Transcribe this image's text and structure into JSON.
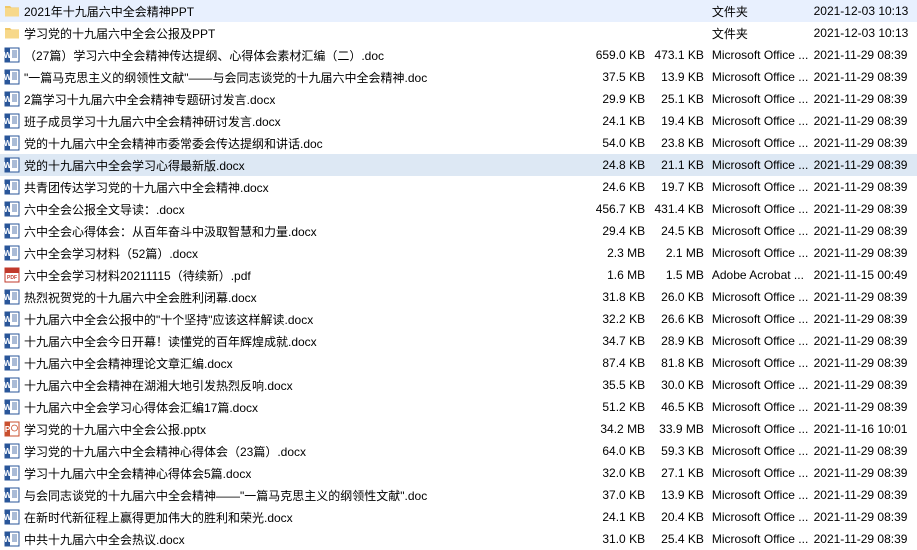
{
  "files": [
    {
      "icon": "folder",
      "name": "2021年十九届六中全会精神PPT",
      "size": "",
      "packed": "",
      "type": "文件夹",
      "date": "2021-12-03 10:13",
      "selected": false
    },
    {
      "icon": "folder",
      "name": "学习党的十九届六中全会公报及PPT",
      "size": "",
      "packed": "",
      "type": "文件夹",
      "date": "2021-12-03 10:13",
      "selected": false
    },
    {
      "icon": "word",
      "name": "（27篇）学习六中全会精神传达提纲、心得体会素材汇编（二）.doc",
      "size": "659.0 KB",
      "packed": "473.1 KB",
      "type": "Microsoft Office ...",
      "date": "2021-11-29 08:39",
      "selected": false
    },
    {
      "icon": "word",
      "name": "\"一篇马克思主义的纲领性文献\"——与会同志谈党的十九届六中全会精神.doc",
      "size": "37.5 KB",
      "packed": "13.9 KB",
      "type": "Microsoft Office ...",
      "date": "2021-11-29 08:39",
      "selected": false
    },
    {
      "icon": "word",
      "name": "2篇学习十九届六中全会精神专题研讨发言.docx",
      "size": "29.9 KB",
      "packed": "25.1 KB",
      "type": "Microsoft Office ...",
      "date": "2021-11-29 08:39",
      "selected": false
    },
    {
      "icon": "word",
      "name": "班子成员学习十九届六中全会精神研讨发言.docx",
      "size": "24.1 KB",
      "packed": "19.4 KB",
      "type": "Microsoft Office ...",
      "date": "2021-11-29 08:39",
      "selected": false
    },
    {
      "icon": "word",
      "name": "党的十九届六中全会精神市委常委会传达提纲和讲话.doc",
      "size": "54.0 KB",
      "packed": "23.8 KB",
      "type": "Microsoft Office ...",
      "date": "2021-11-29 08:39",
      "selected": false
    },
    {
      "icon": "word",
      "name": "党的十九届六中全会学习心得最新版.docx",
      "size": "24.8 KB",
      "packed": "21.1 KB",
      "type": "Microsoft Office ...",
      "date": "2021-11-29 08:39",
      "selected": true
    },
    {
      "icon": "word",
      "name": "共青团传达学习党的十九届六中全会精神.docx",
      "size": "24.6 KB",
      "packed": "19.7 KB",
      "type": "Microsoft Office ...",
      "date": "2021-11-29 08:39",
      "selected": false
    },
    {
      "icon": "word",
      "name": "六中全会公报全文导读：.docx",
      "size": "456.7 KB",
      "packed": "431.4 KB",
      "type": "Microsoft Office ...",
      "date": "2021-11-29 08:39",
      "selected": false
    },
    {
      "icon": "word",
      "name": "六中全会心得体会：从百年奋斗中汲取智慧和力量.docx",
      "size": "29.4 KB",
      "packed": "24.5 KB",
      "type": "Microsoft Office ...",
      "date": "2021-11-29 08:39",
      "selected": false
    },
    {
      "icon": "word",
      "name": "六中全会学习材料（52篇）.docx",
      "size": "2.3 MB",
      "packed": "2.1 MB",
      "type": "Microsoft Office ...",
      "date": "2021-11-29 08:39",
      "selected": false
    },
    {
      "icon": "pdf",
      "name": "六中全会学习材料20211115（待续新）.pdf",
      "size": "1.6 MB",
      "packed": "1.5 MB",
      "type": "Adobe Acrobat ...",
      "date": "2021-11-15 00:49",
      "selected": false
    },
    {
      "icon": "word",
      "name": "热烈祝贺党的十九届六中全会胜利闭幕.docx",
      "size": "31.8 KB",
      "packed": "26.0 KB",
      "type": "Microsoft Office ...",
      "date": "2021-11-29 08:39",
      "selected": false
    },
    {
      "icon": "word",
      "name": "十九届六中全会公报中的\"十个坚持\"应该这样解读.docx",
      "size": "32.2 KB",
      "packed": "26.6 KB",
      "type": "Microsoft Office ...",
      "date": "2021-11-29 08:39",
      "selected": false
    },
    {
      "icon": "word",
      "name": "十九届六中全会今日开幕！读懂党的百年辉煌成就.docx",
      "size": "34.7 KB",
      "packed": "28.9 KB",
      "type": "Microsoft Office ...",
      "date": "2021-11-29 08:39",
      "selected": false
    },
    {
      "icon": "word",
      "name": "十九届六中全会精神理论文章汇编.docx",
      "size": "87.4 KB",
      "packed": "81.8 KB",
      "type": "Microsoft Office ...",
      "date": "2021-11-29 08:39",
      "selected": false
    },
    {
      "icon": "word",
      "name": "十九届六中全会精神在湖湘大地引发热烈反响.docx",
      "size": "35.5 KB",
      "packed": "30.0 KB",
      "type": "Microsoft Office ...",
      "date": "2021-11-29 08:39",
      "selected": false
    },
    {
      "icon": "word",
      "name": "十九届六中全会学习心得体会汇编17篇.docx",
      "size": "51.2 KB",
      "packed": "46.5 KB",
      "type": "Microsoft Office ...",
      "date": "2021-11-29 08:39",
      "selected": false
    },
    {
      "icon": "ppt",
      "name": "学习党的十九届六中全会公报.pptx",
      "size": "34.2 MB",
      "packed": "33.9 MB",
      "type": "Microsoft Office ...",
      "date": "2021-11-16 10:01",
      "selected": false
    },
    {
      "icon": "word",
      "name": "学习党的十九届六中全会精神心得体会（23篇）.docx",
      "size": "64.0 KB",
      "packed": "59.3 KB",
      "type": "Microsoft Office ...",
      "date": "2021-11-29 08:39",
      "selected": false
    },
    {
      "icon": "word",
      "name": "学习十九届六中全会精神心得体会5篇.docx",
      "size": "32.0 KB",
      "packed": "27.1 KB",
      "type": "Microsoft Office ...",
      "date": "2021-11-29 08:39",
      "selected": false
    },
    {
      "icon": "word",
      "name": "与会同志谈党的十九届六中全会精神——\"一篇马克思主义的纲领性文献\".doc",
      "size": "37.0 KB",
      "packed": "13.9 KB",
      "type": "Microsoft Office ...",
      "date": "2021-11-29 08:39",
      "selected": false
    },
    {
      "icon": "word",
      "name": "在新时代新征程上赢得更加伟大的胜利和荣光.docx",
      "size": "24.1 KB",
      "packed": "20.4 KB",
      "type": "Microsoft Office ...",
      "date": "2021-11-29 08:39",
      "selected": false
    },
    {
      "icon": "word",
      "name": "中共十九届六中全会热议.docx",
      "size": "31.0 KB",
      "packed": "25.4 KB",
      "type": "Microsoft Office ...",
      "date": "2021-11-29 08:39",
      "selected": false
    }
  ]
}
